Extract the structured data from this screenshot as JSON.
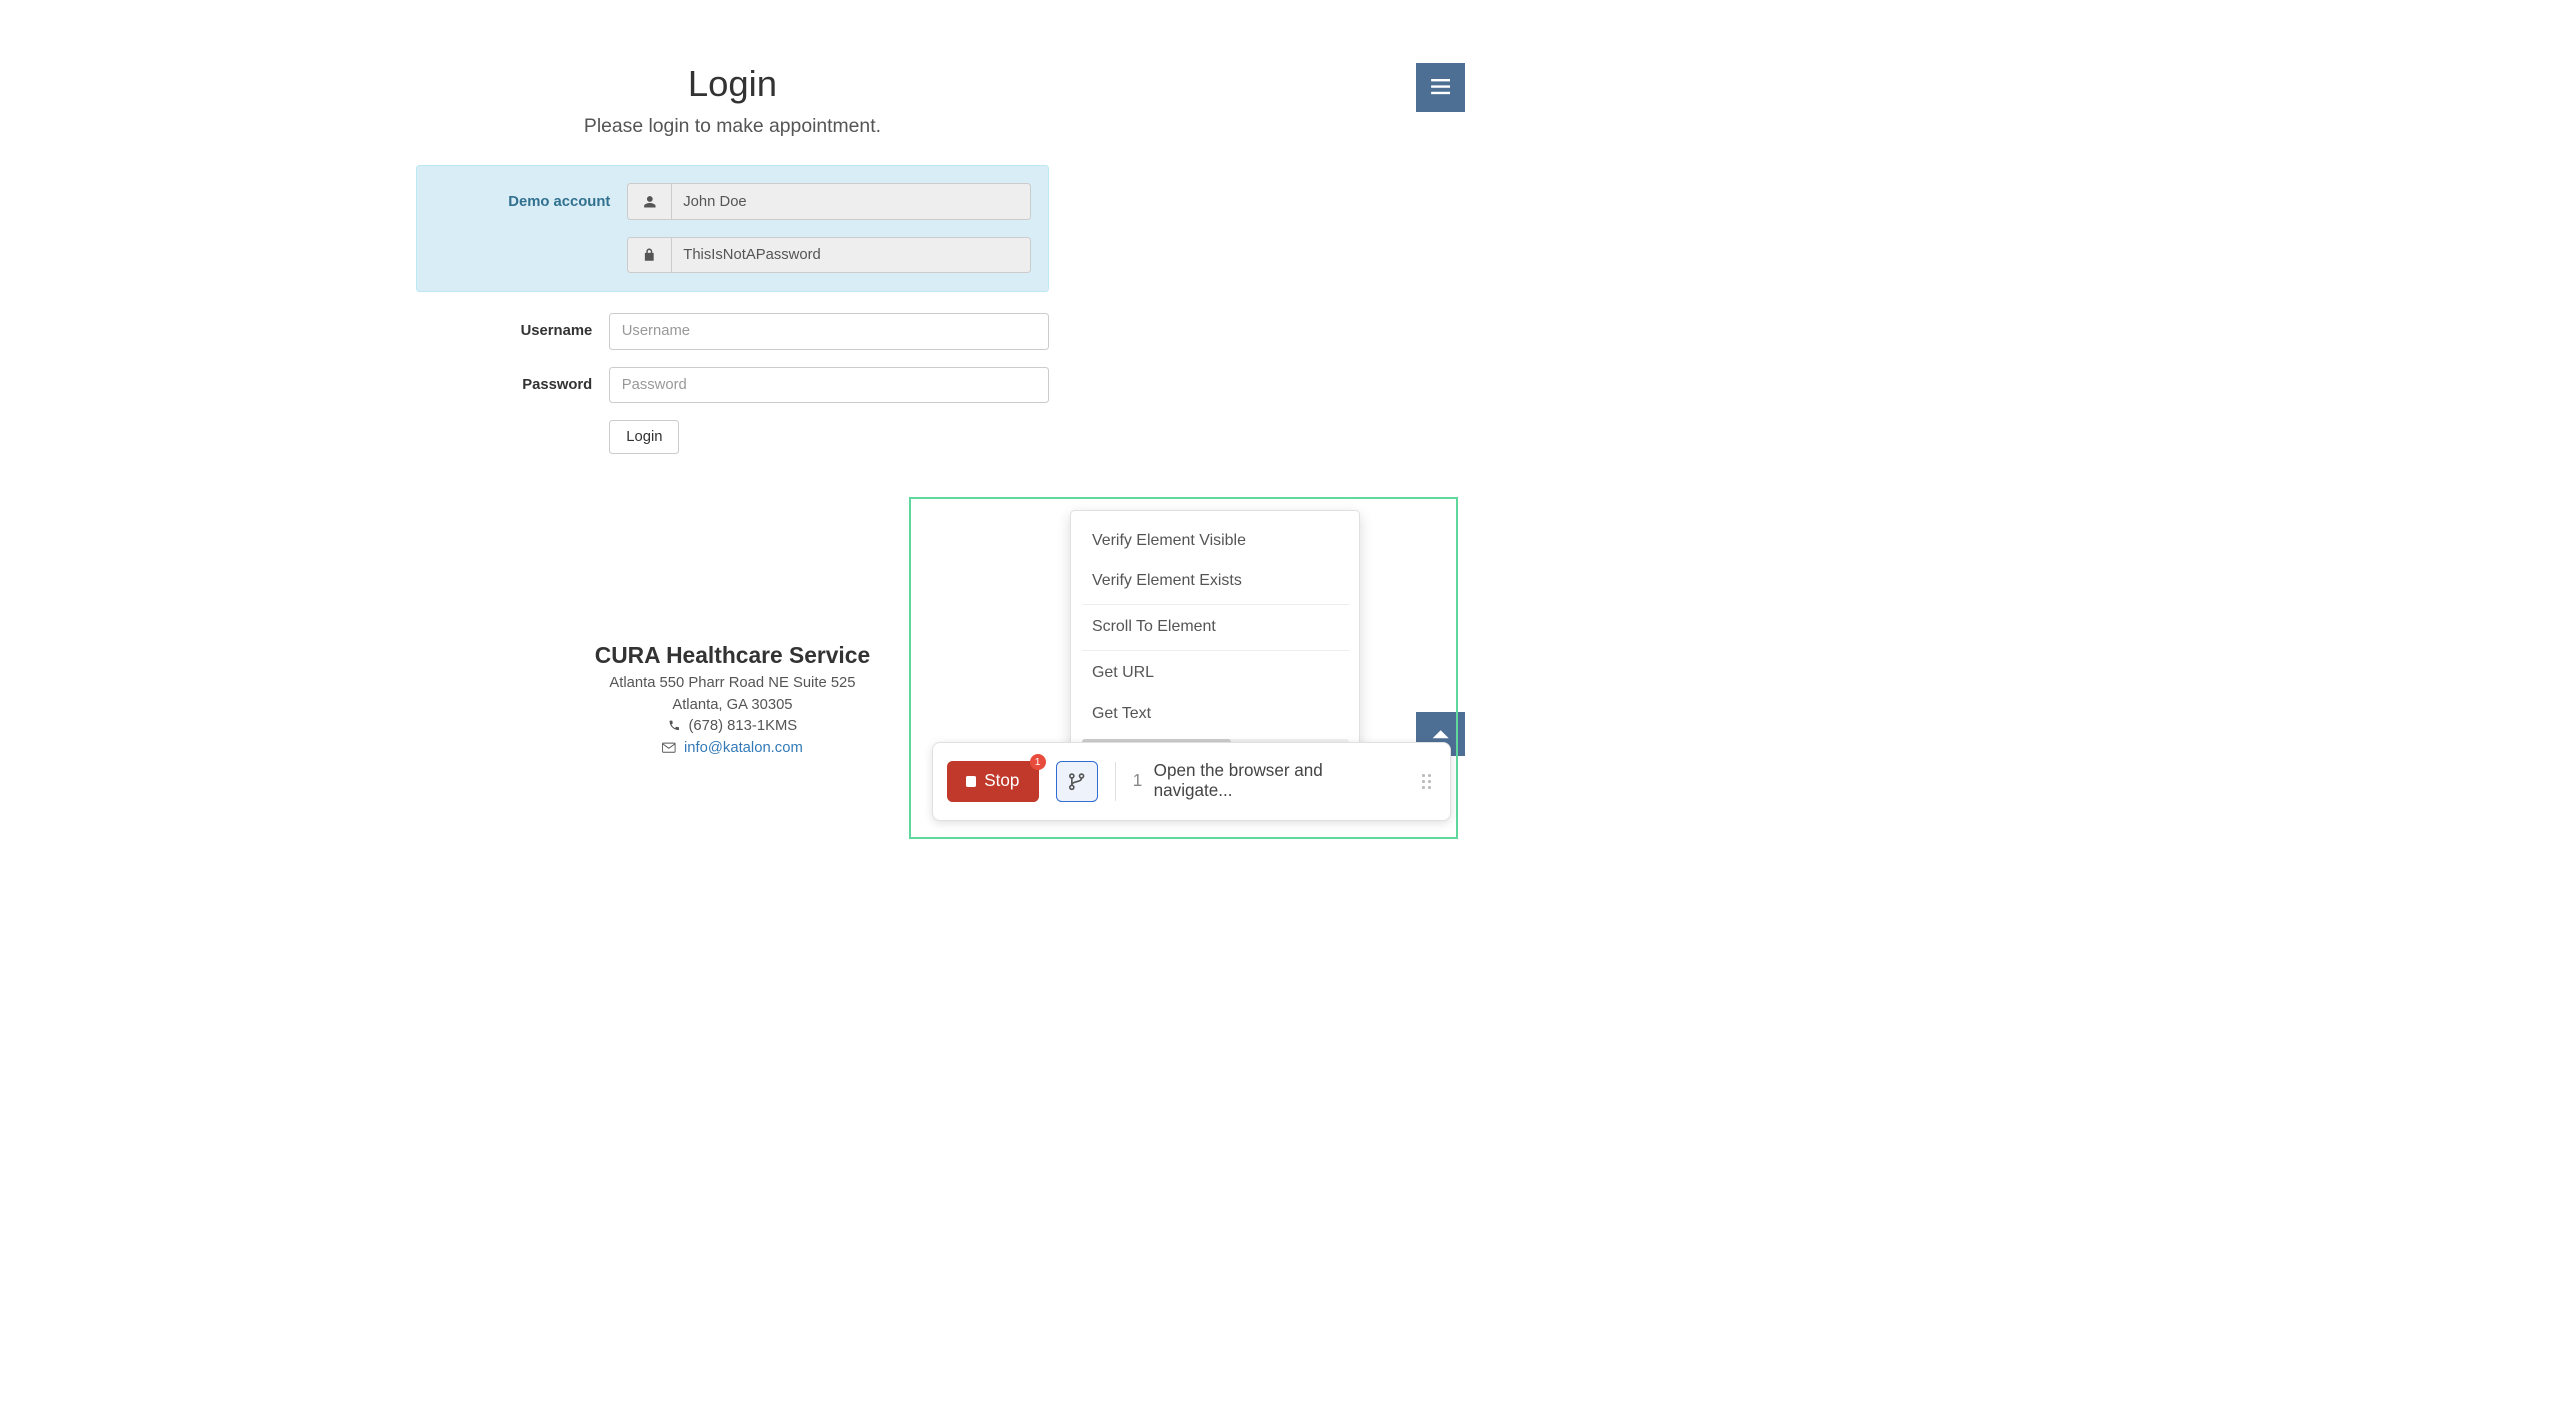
{
  "login": {
    "title": "Login",
    "subtitle": "Please login to make appointment.",
    "demo_label": "Demo account",
    "demo_user": "John Doe",
    "demo_pass": "ThisIsNotAPassword",
    "username_label": "Username",
    "username_placeholder": "Username",
    "password_label": "Password",
    "password_placeholder": "Password",
    "login_btn": "Login"
  },
  "footer": {
    "title": "CURA Healthcare Service",
    "addr1": "Atlanta 550 Pharr Road NE Suite 525",
    "addr2": "Atlanta, GA 30305",
    "phone": "(678) 813-1KMS",
    "email": "info@katalon.com"
  },
  "recorder": {
    "stop": "Stop",
    "badge": "1",
    "step_num": "1",
    "step_text": "Open the browser and navigate..."
  },
  "menu": {
    "i1": "Verify Element Visible",
    "i2": "Verify Element Exists",
    "i3": "Scroll To Element",
    "i4": "Get URL",
    "i5": "Get Text"
  }
}
